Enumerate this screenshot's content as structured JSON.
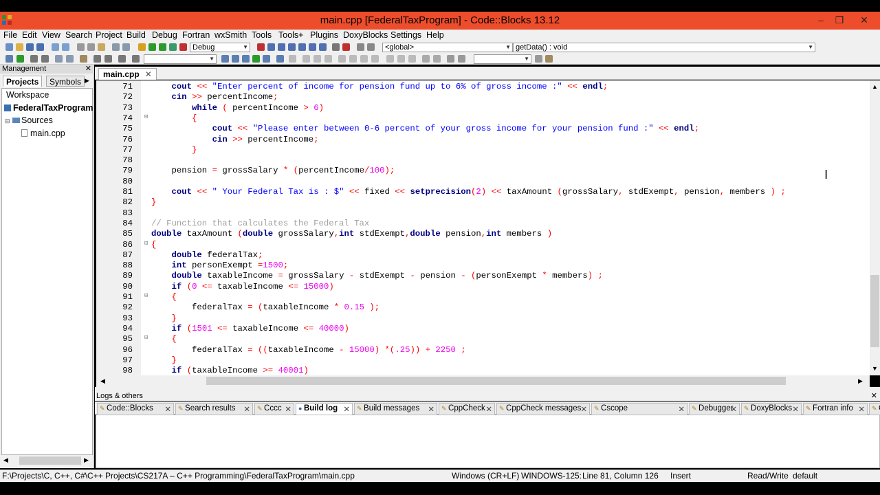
{
  "window": {
    "title": "main.cpp [FederalTaxProgram] - Code::Blocks 13.12",
    "titlebar_color": "#ee4d2b"
  },
  "menu": [
    "File",
    "Edit",
    "View",
    "Search",
    "Project",
    "Build",
    "Debug",
    "Fortran",
    "wxSmith",
    "Tools",
    "Tools+",
    "Plugins",
    "DoxyBlocks",
    "Settings",
    "Help"
  ],
  "toolbar": {
    "build_target": "Debug",
    "scope": "<global>",
    "function": "getData() : void"
  },
  "management": {
    "title": "Management",
    "tabs": [
      "Projects",
      "Symbols"
    ],
    "tree": {
      "workspace": "Workspace",
      "project": "FederalTaxProgram",
      "folder": "Sources",
      "file": "main.cpp"
    }
  },
  "editor": {
    "tab_label": "main.cpp",
    "lines": [
      {
        "n": "71",
        "fold": "",
        "html": "    <span class='kw'>cout</span> <span class='op'>&lt;&lt;</span> <span class='str'>\"Enter percent of income for pension fund up to 6% of gross income :\"</span> <span class='op'>&lt;&lt;</span> <span class='kw'>endl</span><span class='op'>;</span>"
      },
      {
        "n": "72",
        "fold": "",
        "html": "    <span class='kw'>cin</span> <span class='op'>&gt;&gt;</span> percentIncome<span class='op'>;</span>"
      },
      {
        "n": "73",
        "fold": "",
        "html": "        <span class='kw'>while</span> <span class='op'>(</span> percentIncome <span class='op'>&gt;</span> <span class='num'>6</span><span class='op'>)</span>"
      },
      {
        "n": "74",
        "fold": "⊟",
        "html": "        <span class='op'>{</span>"
      },
      {
        "n": "75",
        "fold": "",
        "html": "            <span class='kw'>cout</span> <span class='op'>&lt;&lt;</span> <span class='str'>\"Please enter between 0-6 percent of your gross income for your pension fund :\"</span> <span class='op'>&lt;&lt;</span> <span class='kw'>endl</span><span class='op'>;</span>"
      },
      {
        "n": "76",
        "fold": "",
        "html": "            <span class='kw'>cin</span> <span class='op'>&gt;&gt;</span> percentIncome<span class='op'>;</span>"
      },
      {
        "n": "77",
        "fold": "",
        "html": "        <span class='op'>}</span>"
      },
      {
        "n": "78",
        "fold": "",
        "html": ""
      },
      {
        "n": "79",
        "fold": "",
        "html": "    pension <span class='op'>=</span> grossSalary <span class='op'>*</span> <span class='op'>(</span>percentIncome<span class='op'>/</span><span class='num'>100</span><span class='op'>);</span>"
      },
      {
        "n": "80",
        "fold": "",
        "html": ""
      },
      {
        "n": "81",
        "fold": "",
        "html": "    <span class='kw'>cout</span> <span class='op'>&lt;&lt;</span> <span class='str'>\" Your Federal Tax is : $\"</span> <span class='op'>&lt;&lt;</span> fixed <span class='op'>&lt;&lt;</span> <span class='kw'>setprecision</span><span class='op'>(</span><span class='num'>2</span><span class='op'>)</span> <span class='op'>&lt;&lt;</span> taxAmount <span class='op'>(</span>grossSalary<span class='op'>,</span> stdExempt<span class='op'>,</span> pension<span class='op'>,</span> members <span class='op'>)</span> <span class='op'>;</span>"
      },
      {
        "n": "82",
        "fold": "",
        "html": "<span class='op'>}</span>"
      },
      {
        "n": "83",
        "fold": "",
        "html": ""
      },
      {
        "n": "84",
        "fold": "",
        "html": "<span class='cm'>// Function that calculates the Federal Tax</span>"
      },
      {
        "n": "85",
        "fold": "",
        "html": "<span class='kw'>double</span> taxAmount <span class='op'>(</span><span class='kw'>double</span> grossSalary<span class='op'>,</span><span class='kw'>int</span> stdExempt<span class='op'>,</span><span class='kw'>double</span> pension<span class='op'>,</span><span class='kw'>int</span> members <span class='op'>)</span>"
      },
      {
        "n": "86",
        "fold": "⊟",
        "html": "<span class='op'>{</span>"
      },
      {
        "n": "87",
        "fold": "",
        "html": "    <span class='kw'>double</span> federalTax<span class='op'>;</span>"
      },
      {
        "n": "88",
        "fold": "",
        "html": "    <span class='kw'>int</span> personExempt <span class='op'>=</span><span class='num'>1500</span><span class='op'>;</span>"
      },
      {
        "n": "89",
        "fold": "",
        "html": "    <span class='kw'>double</span> taxableIncome <span class='op'>=</span> grossSalary <span class='op'>-</span> stdExempt <span class='op'>-</span> pension <span class='op'>-</span> <span class='op'>(</span>personExempt <span class='op'>*</span> members<span class='op'>)</span> <span class='op'>;</span>"
      },
      {
        "n": "90",
        "fold": "",
        "html": "    <span class='kw'>if</span> <span class='op'>(</span><span class='num'>0</span> <span class='op'>&lt;=</span> taxableIncome <span class='op'>&lt;=</span> <span class='num'>15000</span><span class='op'>)</span>"
      },
      {
        "n": "91",
        "fold": "⊟",
        "html": "    <span class='op'>{</span>"
      },
      {
        "n": "92",
        "fold": "",
        "html": "        federalTax <span class='op'>=</span> <span class='op'>(</span>taxableIncome <span class='op'>*</span> <span class='num'>0.15</span> <span class='op'>);</span>"
      },
      {
        "n": "93",
        "fold": "",
        "html": "    <span class='op'>}</span>"
      },
      {
        "n": "94",
        "fold": "",
        "html": "    <span class='kw'>if</span> <span class='op'>(</span><span class='num'>1501</span> <span class='op'>&lt;=</span> taxableIncome <span class='op'>&lt;=</span> <span class='num'>40000</span><span class='op'>)</span>"
      },
      {
        "n": "95",
        "fold": "⊟",
        "html": "    <span class='op'>{</span>"
      },
      {
        "n": "96",
        "fold": "",
        "html": "        federalTax <span class='op'>=</span> <span class='op'>((</span>taxableIncome <span class='op'>-</span> <span class='num'>15000</span><span class='op'>)</span> <span class='op'>*(</span><span class='num'>.25</span><span class='op'>))</span> <span class='op'>+</span> <span class='num'>2250</span> <span class='op'>;</span>"
      },
      {
        "n": "97",
        "fold": "",
        "html": "    <span class='op'>}</span>"
      },
      {
        "n": "98",
        "fold": "",
        "html": "    <span class='kw'>if</span> <span class='op'>(</span>taxableIncome <span class='op'>&gt;=</span> <span class='num'>40001</span><span class='op'>)</span>"
      }
    ]
  },
  "logs": {
    "title": "Logs & others",
    "tabs": [
      {
        "label": "Code::Blocks",
        "active": false
      },
      {
        "label": "Search results",
        "active": false
      },
      {
        "label": "Cccc",
        "active": false
      },
      {
        "label": "Build log",
        "active": true
      },
      {
        "label": "Build messages",
        "active": false
      },
      {
        "label": "CppCheck",
        "active": false
      },
      {
        "label": "CppCheck messages",
        "active": false
      },
      {
        "label": "Cscope",
        "active": false
      },
      {
        "label": "Debugger",
        "active": false
      },
      {
        "label": "DoxyBlocks",
        "active": false
      },
      {
        "label": "Fortran info",
        "active": false
      },
      {
        "label": "Clos",
        "active": false
      }
    ]
  },
  "status": {
    "path": "F:\\Projects\\C, C++, C#\\C++ Projects\\CS217A – C++ Programming\\FederalTaxProgram\\main.cpp",
    "eol": "Windows (CR+LF)",
    "encoding": "WINDOWS-125:",
    "position": "Line 81, Column 126",
    "mode": "Insert",
    "access": "Read/Write",
    "lang": "default"
  }
}
